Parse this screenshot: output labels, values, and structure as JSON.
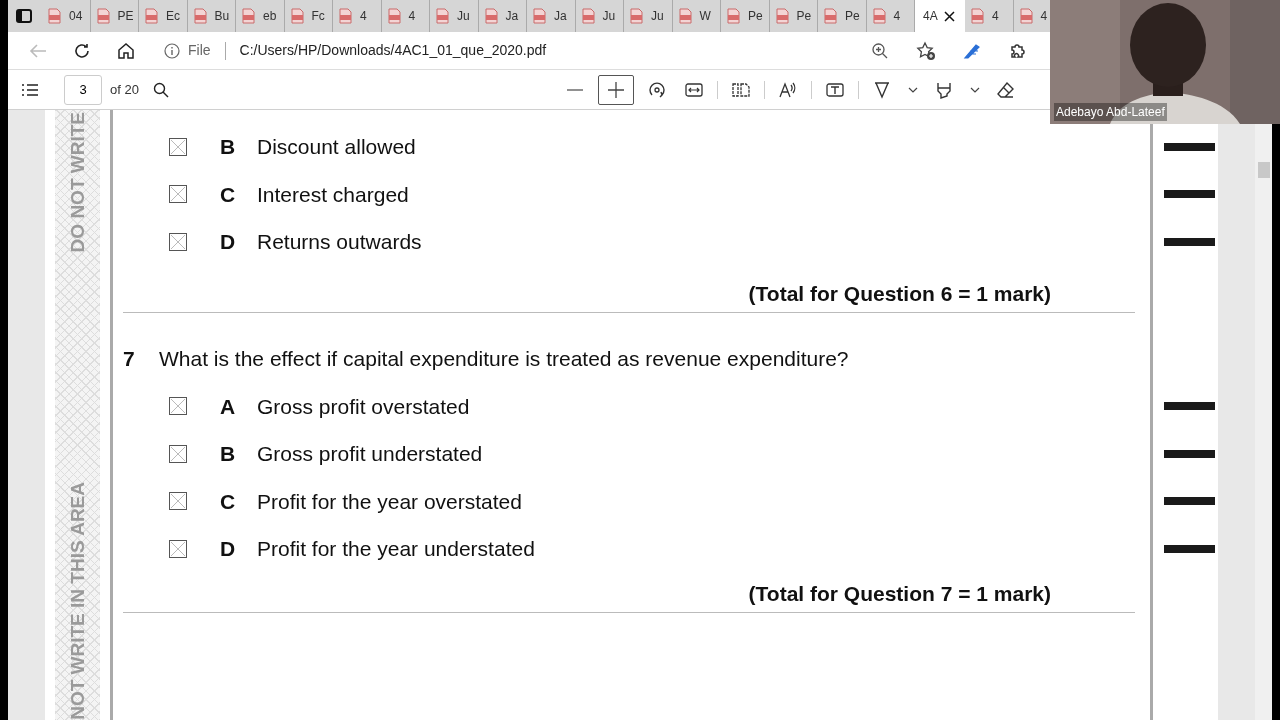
{
  "browser": {
    "tabs": [
      {
        "label": "04",
        "selected": false
      },
      {
        "label": "PE",
        "selected": false
      },
      {
        "label": "Ec",
        "selected": false
      },
      {
        "label": "Bu",
        "selected": false
      },
      {
        "label": "eb",
        "selected": false
      },
      {
        "label": "Fc",
        "selected": false
      },
      {
        "label": "4",
        "selected": false
      },
      {
        "label": "4",
        "selected": false
      },
      {
        "label": "Ju",
        "selected": false
      },
      {
        "label": "Ja",
        "selected": false
      },
      {
        "label": "Ja",
        "selected": false
      },
      {
        "label": "Ju",
        "selected": false
      },
      {
        "label": "Ju",
        "selected": false
      },
      {
        "label": "W",
        "selected": false
      },
      {
        "label": "Pe",
        "selected": false
      },
      {
        "label": "Pe",
        "selected": false
      },
      {
        "label": "Pe",
        "selected": false
      },
      {
        "label": "4",
        "selected": false
      },
      {
        "label": "4A",
        "selected": true
      },
      {
        "label": "4",
        "selected": false
      },
      {
        "label": "4",
        "selected": false
      }
    ],
    "back_disabled": true,
    "address_bar": {
      "security_label": "File",
      "url": "C:/Users/HP/Downloads/4AC1_01_que_2020.pdf"
    }
  },
  "pdf_toolbar": {
    "page_number": "3",
    "page_count": "of 20"
  },
  "document": {
    "margin_texts": [
      "DO NOT WRITE",
      "NOT WRITE IN THIS AREA"
    ],
    "blocks": [
      {
        "kind": "option",
        "letter": "B",
        "text": "Discount allowed",
        "checked": false
      },
      {
        "kind": "option",
        "letter": "C",
        "text": "Interest charged",
        "checked": false
      },
      {
        "kind": "option",
        "letter": "D",
        "text": "Returns outwards",
        "checked": false
      },
      {
        "kind": "total",
        "text": "(Total for Question 6 = 1 mark)"
      },
      {
        "kind": "question",
        "number": "7",
        "text": "What is the effect if capital expenditure is treated as revenue expenditure?"
      },
      {
        "kind": "option",
        "letter": "A",
        "text": "Gross profit overstated",
        "checked": false
      },
      {
        "kind": "option",
        "letter": "B",
        "text": "Gross profit understated",
        "checked": false
      },
      {
        "kind": "option",
        "letter": "C",
        "text": "Profit for the year overstated",
        "checked": false
      },
      {
        "kind": "option",
        "letter": "D",
        "text": "Profit for the year understated",
        "checked": false
      },
      {
        "kind": "total",
        "text": "(Total for Question 7 = 1 mark)"
      }
    ]
  },
  "webcam": {
    "name": "Adebayo Abd-Lateef"
  }
}
